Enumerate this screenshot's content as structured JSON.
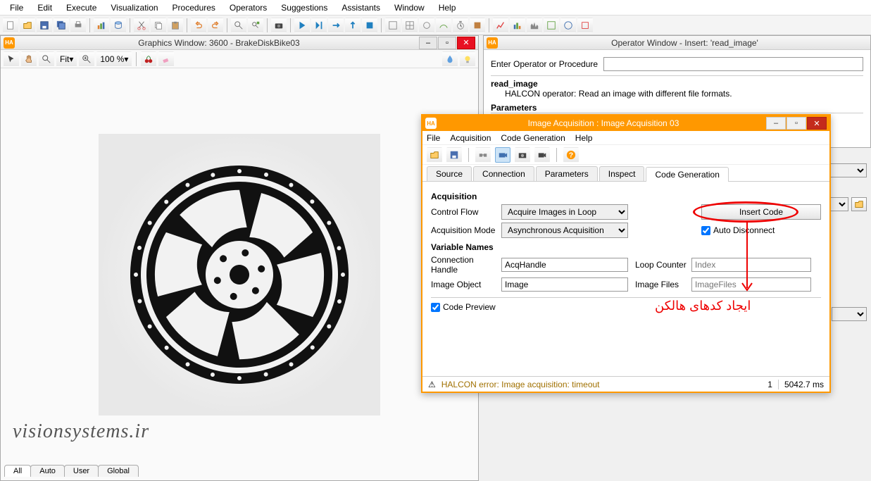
{
  "menu": [
    "File",
    "Edit",
    "Execute",
    "Visualization",
    "Procedures",
    "Operators",
    "Suggestions",
    "Assistants",
    "Window",
    "Help"
  ],
  "graphicsWindow": {
    "title": "Graphics Window: 3600 - BrakeDiskBike03",
    "fit": "Fit",
    "zoom": "100 %"
  },
  "operatorWindow": {
    "title": "Operator Window - Insert: 'read_image'",
    "enterLabel": "Enter Operator or Procedure",
    "opName": "read_image",
    "opDesc": "HALCON operator:  Read an image with different file formats.",
    "paramsHead": "Parameters"
  },
  "iaWindow": {
    "title": "Image Acquisition : Image Acquisition 03",
    "menu": [
      "File",
      "Acquisition",
      "Code Generation",
      "Help"
    ],
    "tabs": [
      "Source",
      "Connection",
      "Parameters",
      "Inspect",
      "Code Generation"
    ],
    "activeTab": 4,
    "acquisitionHead": "Acquisition",
    "controlFlowLabel": "Control Flow",
    "controlFlowValue": "Acquire Images in Loop",
    "acqModeLabel": "Acquisition Mode",
    "acqModeValue": "Asynchronous Acquisition",
    "insertCode": "Insert Code",
    "autoDisconnect": "Auto Disconnect",
    "varNamesHead": "Variable Names",
    "connHandleLabel": "Connection Handle",
    "connHandleValue": "AcqHandle",
    "imgObjLabel": "Image Object",
    "imgObjValue": "Image",
    "loopCounterLabel": "Loop Counter",
    "loopCounterPh": "Index",
    "imageFilesLabel": "Image Files",
    "imageFilesPh": "ImageFiles",
    "codePreview": "Code Preview",
    "statusErr": "HALCON error: Image acquisition: timeout",
    "statusNum": "1",
    "statusTime": "5042.7 ms"
  },
  "annotation": "ایجاد کدهای هالکن",
  "watermark": "visionsystems.ir",
  "varTabs": [
    "All",
    "Auto",
    "User",
    "Global"
  ]
}
